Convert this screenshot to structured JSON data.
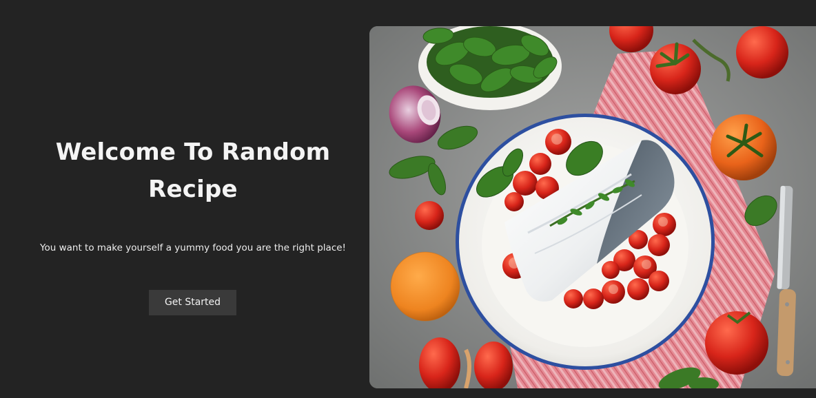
{
  "hero": {
    "title": "Welcome To Random Recipe",
    "subtitle": "You want to make yourself a yummy food you are the right place!",
    "cta_label": "Get Started"
  },
  "colors": {
    "background": "#232323",
    "button_bg": "#3a3a3a",
    "text": "#f4f4f4"
  }
}
